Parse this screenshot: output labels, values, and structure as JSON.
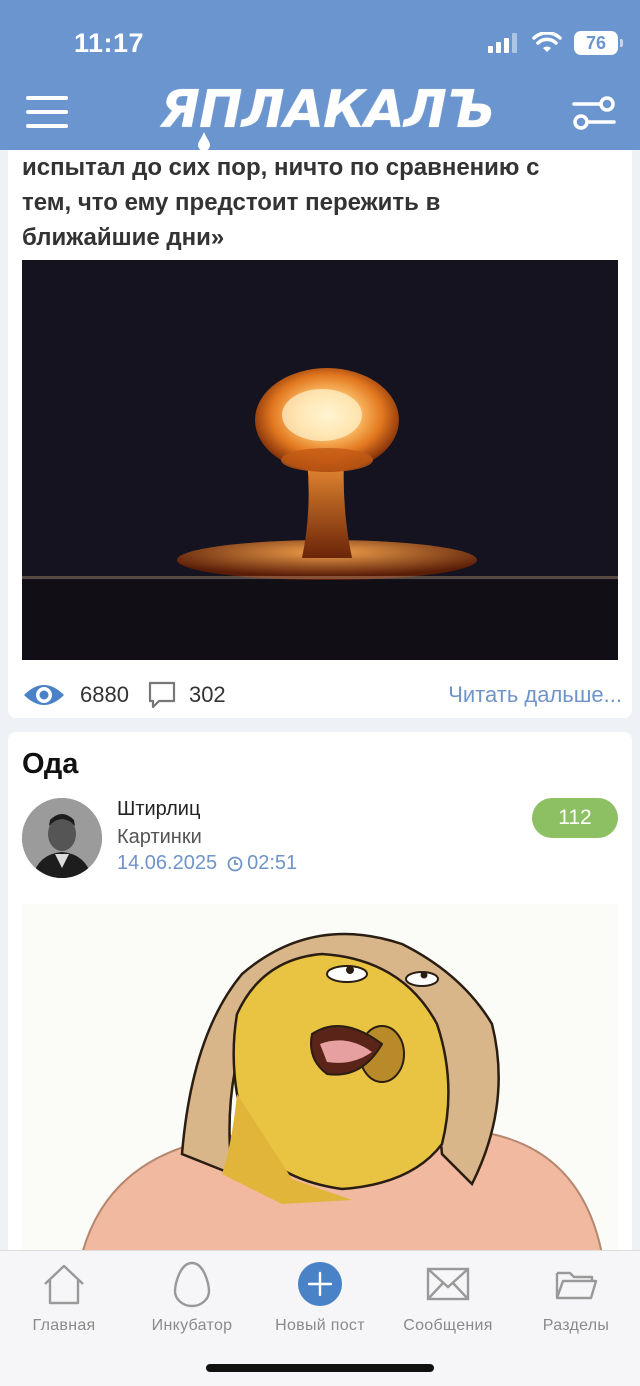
{
  "status_bar": {
    "time": "11:17",
    "battery": "76"
  },
  "header": {
    "logo_text": "ЯПЛАКАЛЪ",
    "menu_icon": "hamburger-menu-icon",
    "filter_icon": "sliders-icon"
  },
  "post1": {
    "text_lines": [
      "испытал до сих пор, ничто по сравнению с",
      "тем, что ему предстоит пережить в",
      "ближайшие дни»"
    ],
    "image": "nuclear-explosion-photo",
    "views": "6880",
    "comments": "302",
    "read_more": "Читать дальше..."
  },
  "post2": {
    "title": "Ода",
    "author": "Штирлиц",
    "category": "Картинки",
    "date": "14.06.2025",
    "time": "02:51",
    "rating": "112",
    "image": "pencil-drawing-woman"
  },
  "tabbar": {
    "tabs": [
      {
        "label": "Главная",
        "icon": "home-icon"
      },
      {
        "label": "Инкубатор",
        "icon": "egg-icon"
      },
      {
        "label": "Новый пост",
        "icon": "plus-circle-icon"
      },
      {
        "label": "Сообщения",
        "icon": "envelope-icon"
      },
      {
        "label": "Разделы",
        "icon": "folder-icon"
      }
    ]
  },
  "colors": {
    "header_bg": "#6b95cf",
    "accent": "#6f94c8",
    "rating_bg": "#8cc063",
    "page_bg": "#eef1f5"
  }
}
